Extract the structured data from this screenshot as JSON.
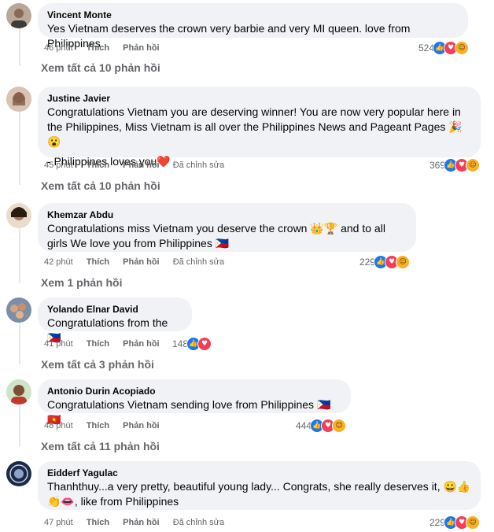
{
  "labels": {
    "like": "Thích",
    "reply": "Phản hồi",
    "edited": "Đã chỉnh sửa"
  },
  "icons": {
    "like": "like-icon",
    "love": "love-icon",
    "care": "care-icon"
  },
  "colors": {
    "bubble": "#f0f2f5",
    "secondary_text": "#65676b",
    "like": "#1877f2",
    "love": "#f33e58",
    "care": "#f7b125"
  },
  "comments": [
    {
      "author": "Vincent Monte",
      "lines": [
        "Yes Vietnam deserves the crown very barbie and very MI queen. love from Philippines"
      ],
      "time": "46 phút",
      "edited": false,
      "reaction_count": "524",
      "view_replies": "Xem tất cả 10 phản hồi"
    },
    {
      "author": "Justine Javier",
      "lines": [
        "Congratulations Vietnam you are deserving winner! You are now very popular here in the Philippines, Miss Vietnam is all over the Philippines News and Pageant Pages 🎉😮",
        "- Philippines loves you❤️"
      ],
      "time": "45 phút",
      "edited": true,
      "reaction_count": "369",
      "view_replies": "Xem tất cả 10 phản hồi"
    },
    {
      "author": "Khemzar Abdu",
      "lines": [
        "Congratulations miss Vietnam you deserve the crown 👑🏆 and to all girls We love you from Philippines 🇵🇭"
      ],
      "time": "42 phút",
      "edited": true,
      "reaction_count": "229",
      "view_replies": "Xem 1 phản hồi"
    },
    {
      "author": "Yolando Elnar David",
      "lines": [
        "Congratulations from the 🇵🇭"
      ],
      "time": "41 phút",
      "edited": false,
      "reaction_count": "148",
      "view_replies": "Xem tất cả 3 phản hồi"
    },
    {
      "author": "Antonio Durin Acopiado",
      "lines": [
        "Congratulations Vietnam sending love from Philippines 🇵🇭🇻🇳"
      ],
      "time": "48 phút",
      "edited": false,
      "reaction_count": "444",
      "view_replies": "Xem tất cả 11 phản hồi"
    },
    {
      "author": "Eidderf Yagulac",
      "lines": [
        "Thanhthuy...a very pretty, beautiful young lady... Congrats, she really deserves it, 😀👍 👏👄, like from Philippines"
      ],
      "time": "47 phút",
      "edited": true,
      "reaction_count": "229",
      "view_replies": ""
    }
  ]
}
